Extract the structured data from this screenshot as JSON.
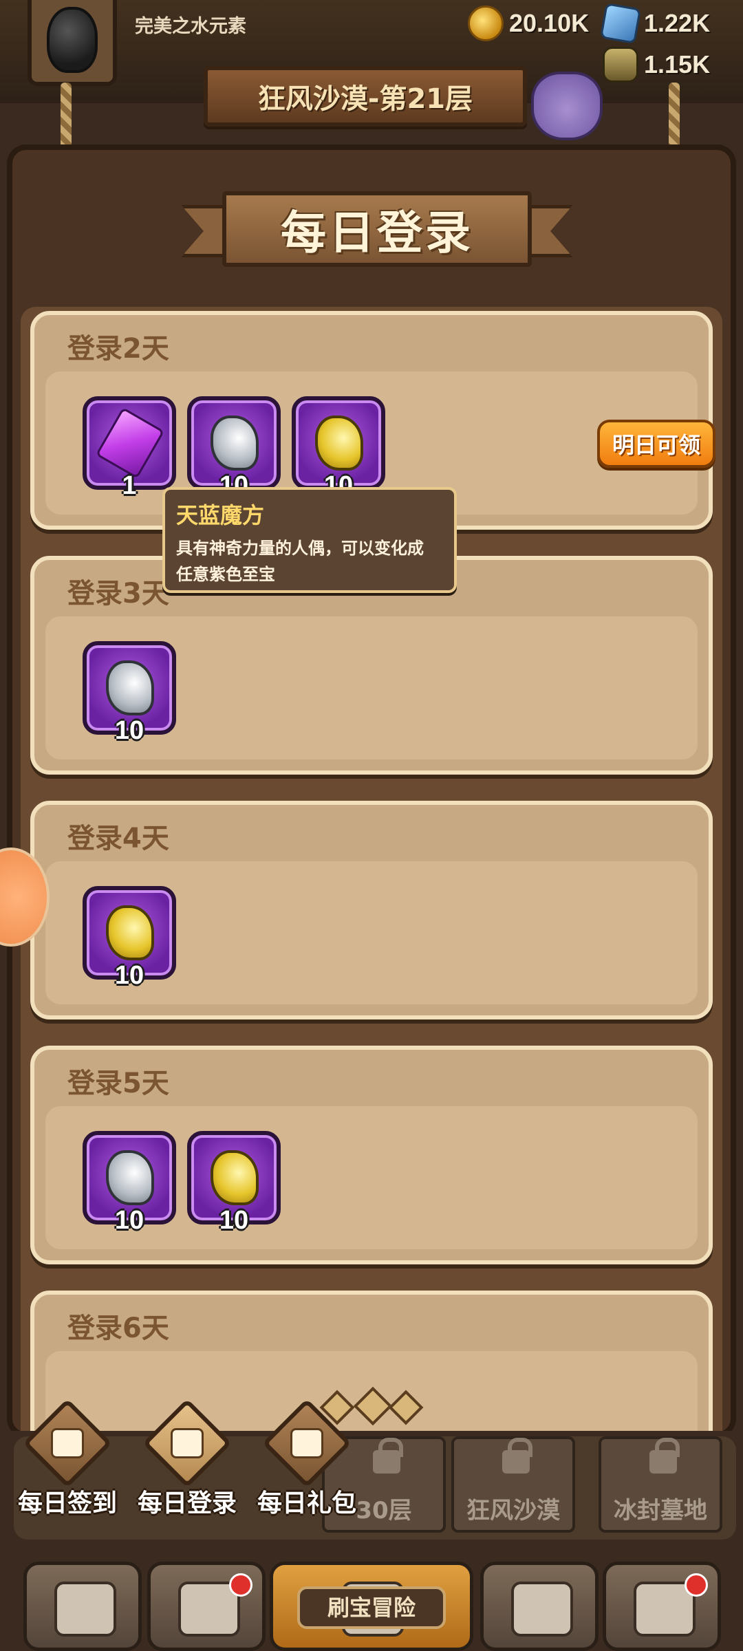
{
  "hud": {
    "player_name": "完美之水元素",
    "gold": "20.10K",
    "gems": "1.22K",
    "jars": "1.15K",
    "floor_title": "狂风沙漠-第21层"
  },
  "panel": {
    "title": "每日登录",
    "claim_label": "明日可领",
    "days": [
      {
        "label": "登录2天",
        "items": [
          {
            "icon": "purple-cube-icon",
            "qty": "1"
          },
          {
            "icon": "silver-scroll-icon",
            "qty": "10"
          },
          {
            "icon": "gold-scroll-icon",
            "qty": "10"
          }
        ]
      },
      {
        "label": "登录3天",
        "items": [
          {
            "icon": "silver-scroll-icon",
            "qty": "10"
          }
        ]
      },
      {
        "label": "登录4天",
        "items": [
          {
            "icon": "gold-scroll-icon",
            "qty": "10"
          }
        ]
      },
      {
        "label": "登录5天",
        "items": [
          {
            "icon": "silver-scroll-icon",
            "qty": "10"
          },
          {
            "icon": "gold-scroll-icon",
            "qty": "10"
          }
        ]
      },
      {
        "label": "登录6天",
        "items": []
      }
    ],
    "tooltip": {
      "title": "天蓝魔方",
      "line1": "具有神奇力量的人偶，可以变化成",
      "line2": "任意紫色至宝"
    }
  },
  "tabs": [
    {
      "label": "每日签到",
      "icon": "calendar-check-icon"
    },
    {
      "label": "每日登录",
      "icon": "gift-icon"
    },
    {
      "label": "每日礼包",
      "icon": "money-bag-icon"
    }
  ],
  "stages": [
    {
      "label": "30层"
    },
    {
      "label": "狂风沙漠"
    },
    {
      "label": "冰封墓地"
    }
  ],
  "nav": {
    "center_label": "刷宝冒险",
    "buttons": [
      "shop-icon",
      "hero-icon",
      "adventure-map-icon",
      "backpack-icon",
      "forge-icon"
    ]
  },
  "colors": {
    "accent_orange": "#f07d10",
    "tooltip_title": "#ffd86b",
    "card_bg": "#c7a983",
    "item_purple": "#6a22a3"
  }
}
